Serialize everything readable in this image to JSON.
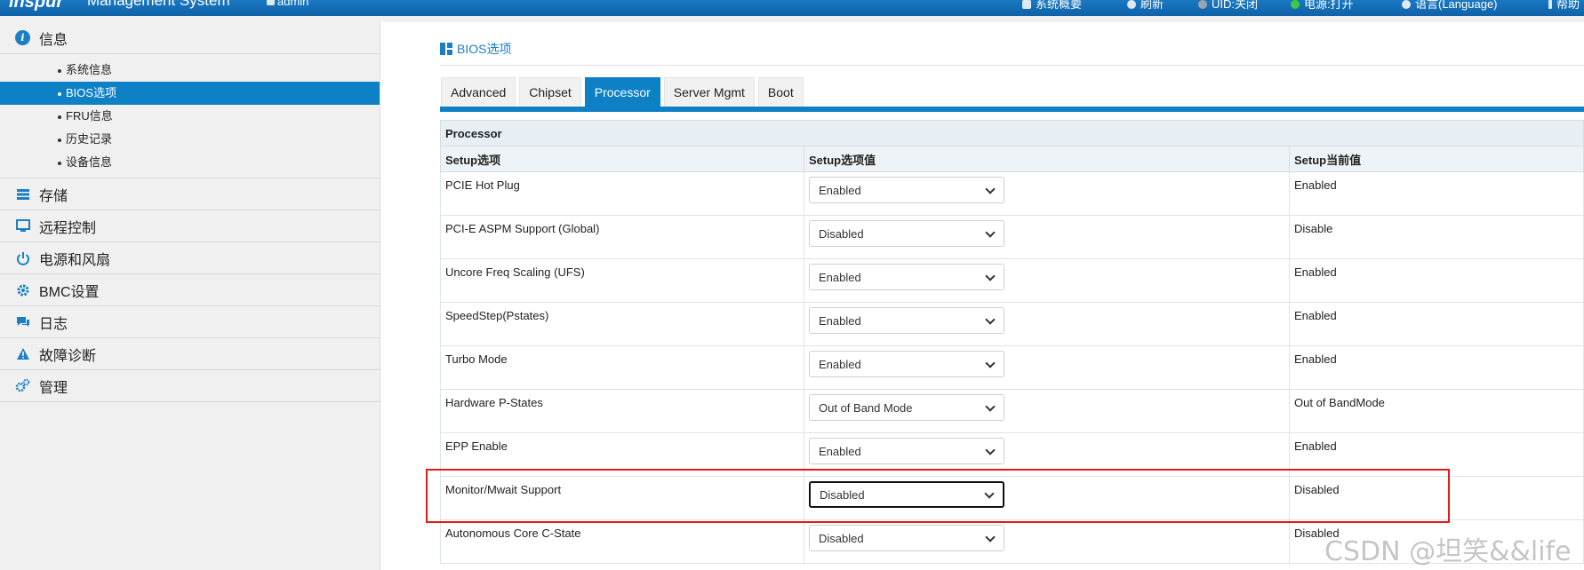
{
  "header": {
    "brand": "inspur",
    "system_title": "Management System",
    "user": "admin",
    "items": [
      {
        "label": "系统概要",
        "icon": "overview-icon"
      },
      {
        "label": "刷新",
        "icon": "refresh-icon"
      },
      {
        "label": "UID:关闭",
        "icon": "uid-icon"
      },
      {
        "label": "电源:打开",
        "icon": "power-status-icon"
      },
      {
        "label": "语言(Language)",
        "icon": "language-icon"
      },
      {
        "label": "帮助",
        "icon": "help-icon"
      }
    ]
  },
  "sidebar": {
    "info": {
      "label": "信息",
      "icon": "info-icon"
    },
    "sub_items": [
      {
        "label": "系统信息"
      },
      {
        "label": "BIOS选项",
        "active": true
      },
      {
        "label": "FRU信息"
      },
      {
        "label": "历史记录"
      },
      {
        "label": "设备信息"
      }
    ],
    "items": [
      {
        "label": "存储",
        "icon": "storage-icon"
      },
      {
        "label": "远程控制",
        "icon": "monitor-icon"
      },
      {
        "label": "电源和风扇",
        "icon": "power-icon"
      },
      {
        "label": "BMC设置",
        "icon": "gear-icon"
      },
      {
        "label": "日志",
        "icon": "chat-icon"
      },
      {
        "label": "故障诊断",
        "icon": "warning-icon"
      },
      {
        "label": "管理",
        "icon": "gears-icon"
      }
    ]
  },
  "main": {
    "page_title": "BIOS选项",
    "tabs": [
      {
        "label": "Advanced"
      },
      {
        "label": "Chipset"
      },
      {
        "label": "Processor",
        "active": true
      },
      {
        "label": "Server Mgmt"
      },
      {
        "label": "Boot"
      }
    ],
    "table": {
      "section": "Processor",
      "headers": [
        "Setup选项",
        "Setup选项值",
        "Setup当前值"
      ],
      "rows": [
        {
          "name": "PCIE Hot Plug",
          "value": "Enabled",
          "current": "Enabled"
        },
        {
          "name": "PCI-E ASPM Support (Global)",
          "value": "Disabled",
          "current": "Disable"
        },
        {
          "name": "Uncore Freq Scaling (UFS)",
          "value": "Enabled",
          "current": "Enabled"
        },
        {
          "name": "SpeedStep(Pstates)",
          "value": "Enabled",
          "current": "Enabled"
        },
        {
          "name": "Turbo Mode",
          "value": "Enabled",
          "current": "Enabled"
        },
        {
          "name": "Hardware P-States",
          "value": "Out of Band Mode",
          "current": "Out of BandMode"
        },
        {
          "name": "EPP Enable",
          "value": "Enabled",
          "current": "Enabled"
        },
        {
          "name": "Monitor/Mwait Support",
          "value": "Disabled",
          "current": "Disabled",
          "focused": true
        },
        {
          "name": "Autonomous Core C-State",
          "value": "Disabled",
          "current": "Disabled"
        }
      ]
    }
  },
  "watermark": "CSDN @坦笑&&life",
  "colors": {
    "accent": "#0d80c6",
    "header_bg": "#1a78c2",
    "highlight": "#e21b1b"
  }
}
